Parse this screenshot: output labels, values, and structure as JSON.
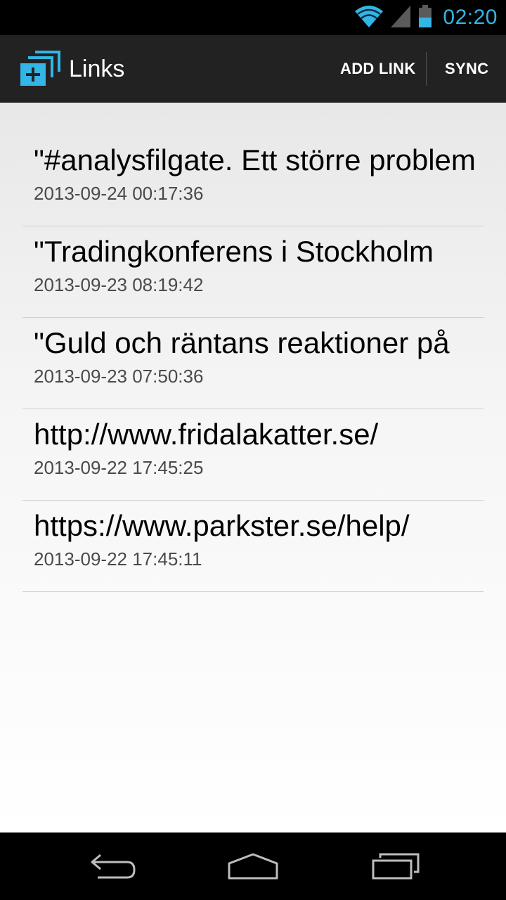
{
  "status_bar": {
    "time": "02:20",
    "icons": [
      "wifi-icon",
      "signal-icon",
      "battery-icon"
    ],
    "accent_color": "#33b5e5"
  },
  "action_bar": {
    "title": "Links",
    "app_icon": "stacked-windows-plus-icon",
    "add_link_label": "ADD LINK",
    "sync_label": "SYNC"
  },
  "links": [
    {
      "title": "\"#analysfilgate. Ett större problem",
      "date": "2013-09-24 00:17:36"
    },
    {
      "title": "\"Tradingkonferens i Stockholm",
      "date": "2013-09-23 08:19:42"
    },
    {
      "title": "\"Guld och räntans reaktioner på",
      "date": "2013-09-23 07:50:36"
    },
    {
      "title": "http://www.fridalakatter.se/",
      "date": "2013-09-22 17:45:25"
    },
    {
      "title": "https://www.parkster.se/help/",
      "date": "2013-09-22 17:45:11"
    }
  ],
  "nav_bar": {
    "icons": [
      "back-icon",
      "home-icon",
      "recent-apps-icon"
    ]
  }
}
